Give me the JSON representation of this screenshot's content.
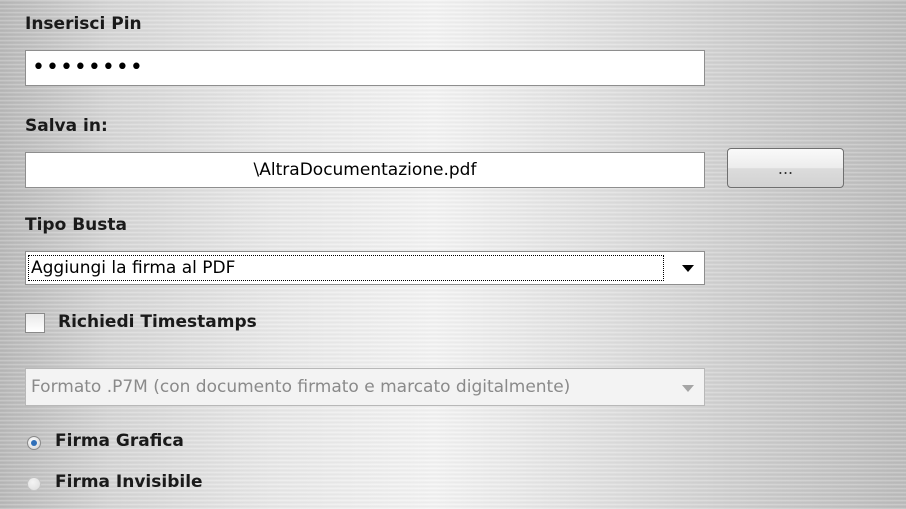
{
  "pin": {
    "label": "Inserisci Pin",
    "masked_value": "••••••••"
  },
  "save": {
    "label": "Salva in:",
    "path": "\\AltraDocumentazione.pdf",
    "browse_label": "..."
  },
  "envelope": {
    "label": "Tipo Busta",
    "selected": "Aggiungi la firma al PDF"
  },
  "timestamp": {
    "label": "Richiedi Timestamps",
    "checked": false
  },
  "format": {
    "selected": "Formato .P7M (con documento firmato e marcato digitalmente)",
    "disabled": true
  },
  "signature": {
    "options": [
      {
        "label": "Firma Grafica",
        "selected": true
      },
      {
        "label": "Firma Invisibile",
        "selected": false
      }
    ]
  }
}
